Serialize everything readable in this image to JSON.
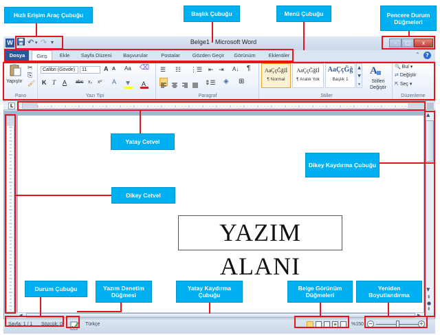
{
  "window": {
    "title": "Belge1 - Microsoft Word",
    "controls": {
      "minimize": "–",
      "maximize": "□",
      "close": "x"
    }
  },
  "quick_access": {
    "icons": [
      "word-logo-icon",
      "save-icon",
      "undo-icon",
      "redo-icon",
      "customize-icon"
    ],
    "logo_letter": "W"
  },
  "menu": {
    "tabs": [
      "Dosya",
      "Giriş",
      "Ekle",
      "Sayfa Düzeni",
      "Başvurular",
      "Postalar",
      "Gözden Geçir",
      "Görünüm",
      "Eklentiler"
    ]
  },
  "ribbon": {
    "clipboard": {
      "paste_label": "Yapıştır",
      "group_label": "Pano"
    },
    "font": {
      "font_name": "Calibri (Gövde)",
      "font_size": "11",
      "group_label": "Yazı Tipi",
      "bold": "K",
      "italic": "T",
      "underline": "A",
      "strike": "abc",
      "sub": "x₂",
      "sup": "x²",
      "grow": "A",
      "shrink": "A",
      "case": "Aa"
    },
    "paragraph": {
      "group_label": "Paragraf"
    },
    "styles": {
      "group_label": "Stiller",
      "items": [
        {
          "preview": "AaÇçĞğIİ",
          "name": "¶ Normal"
        },
        {
          "preview": "AaÇçĞğIİ",
          "name": "¶ Aralık Yok"
        },
        {
          "preview": "AaÇçĞğ",
          "name": "Başlık 1"
        }
      ],
      "change_label": "Stilleri Değiştir"
    },
    "editing": {
      "group_label": "Düzenleme",
      "find": "Bul",
      "replace": "Değiştir",
      "select": "Seç"
    }
  },
  "document": {
    "text": "YAZIM ALANI"
  },
  "statusbar": {
    "page": "Sayfa: 1 / 1",
    "words": "Sözcük: 0",
    "language": "Türkçe",
    "zoom": "%150"
  },
  "callouts": {
    "quick_access": "Hızlı Erişim Araç Çubuğu",
    "title_bar": "Başlık Çubuğu",
    "menu_bar": "Menü Çubuğu",
    "window_buttons": "Pencere Durum Düğmeleri",
    "h_ruler": "Yatay Cetvel",
    "v_scroll": "Dikey Kaydırma Çubuğu",
    "v_ruler": "Dikey Cetvel",
    "status_bar": "Durum Çubuğu",
    "spell_check": "Yazım Denetim Düğmesi",
    "h_scroll": "Yatay Kaydırma Çubuğu",
    "view_buttons": "Belge Görünüm Düğmeleri",
    "resize": "Yeniden Boyutlandırma"
  },
  "colors": {
    "callout": "#00b0f0",
    "highlight": "#e8141c",
    "file_tab": "#2b579a"
  }
}
